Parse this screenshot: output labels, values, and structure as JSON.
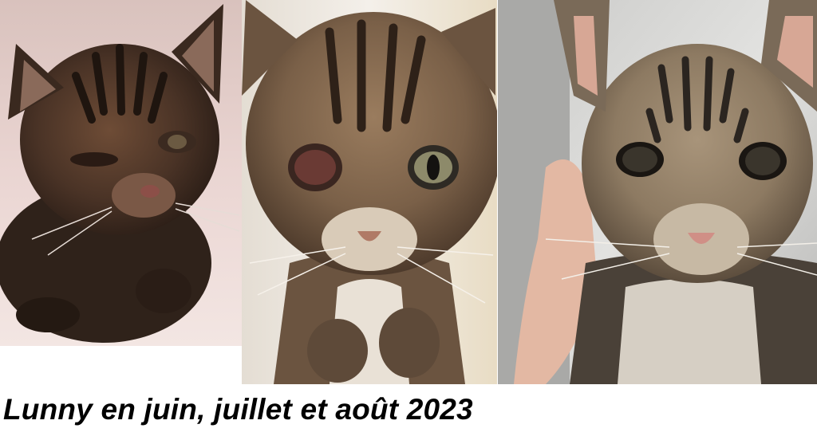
{
  "caption": "Lunny en juin, juillet et août 2023",
  "photos": [
    {
      "subject": "tabby-kitten-june",
      "background_color": "#e9d2cf",
      "fur_color": "#4a3326"
    },
    {
      "subject": "tabby-kitten-july",
      "background_color": "#f2ede7",
      "fur_color": "#7a6048"
    },
    {
      "subject": "tabby-cat-august",
      "background_color": "#d8d8d6",
      "fur_color": "#8d7a62"
    }
  ]
}
